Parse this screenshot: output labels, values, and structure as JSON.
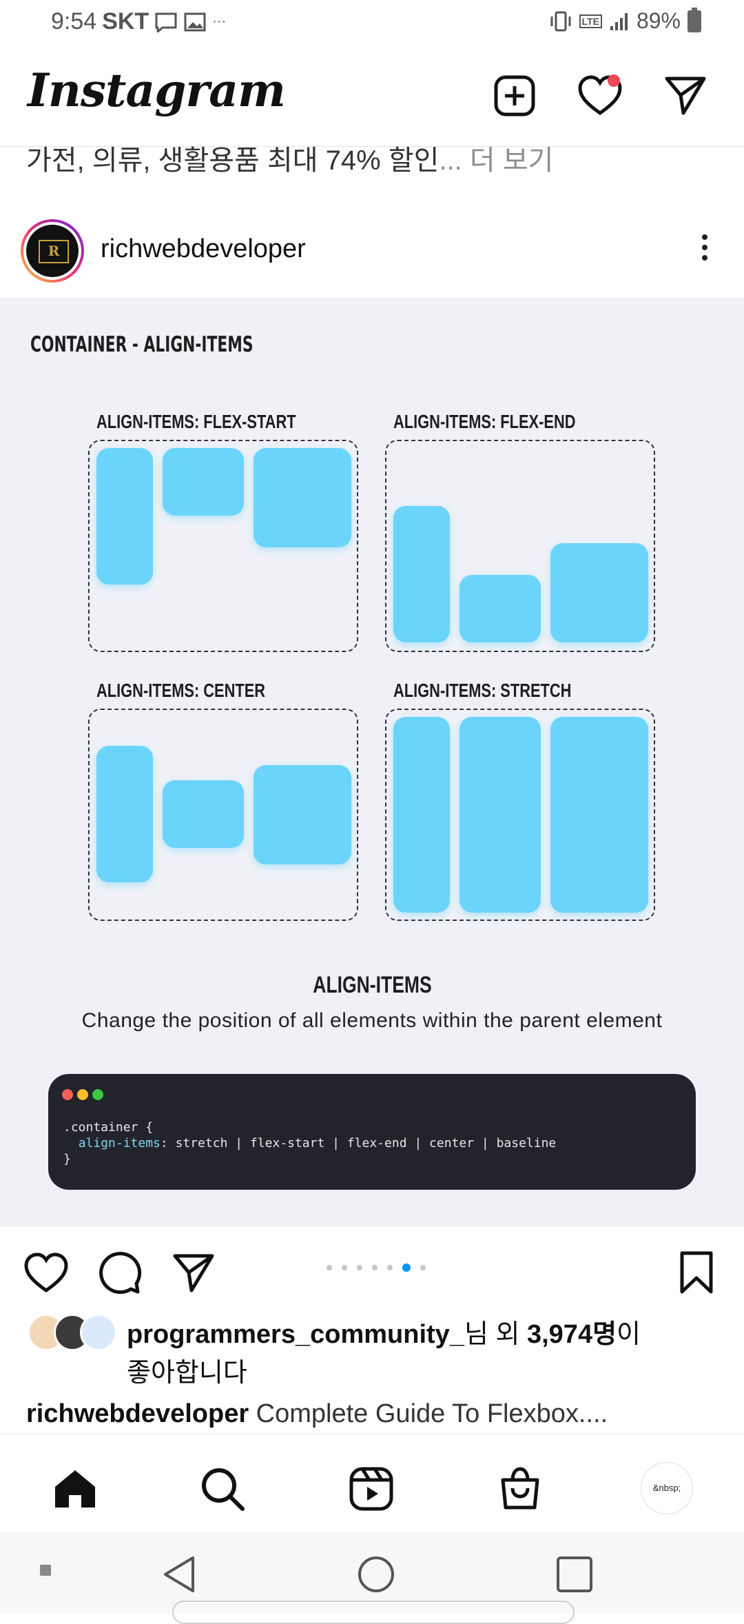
{
  "status_bar": {
    "time": "9:54",
    "carrier": "SKT",
    "more": "···",
    "network": "LTE",
    "battery": "89%"
  },
  "header": {
    "logo": "Instagram",
    "icons": [
      "new-post-icon",
      "heart-icon",
      "send-icon"
    ]
  },
  "previous_post": {
    "caption_cut": "가전, 의류, 생활용품 최대 74% 할인",
    "more_label": "... 더 보기"
  },
  "post": {
    "username": "richwebdeveloper",
    "avatar_letter": "R",
    "image": {
      "title": "CONTAINER - ALIGN-ITEMS",
      "panels": [
        {
          "label": "ALIGN-ITEMS: FLEX-START"
        },
        {
          "label": "ALIGN-ITEMS: FLEX-END"
        },
        {
          "label": "ALIGN-ITEMS: CENTER"
        },
        {
          "label": "ALIGN-ITEMS: STRETCH"
        }
      ],
      "section_title": "ALIGN-ITEMS",
      "description": "Change the position of all elements within the parent element",
      "code": {
        "line1": ".container {",
        "prop": "align-items",
        "values": ": stretch | flex-start | flex-end | center | baseline",
        "line3": "}"
      },
      "colors": {
        "box": "#6ad4fb",
        "background": "#eff1f7",
        "code_bg": "#23232b"
      }
    },
    "carousel": {
      "count": 7,
      "active_index": 5
    },
    "likes": {
      "user": "programmers_community_",
      "mid": "님 외 ",
      "count": "3,974명",
      "suffix": "이",
      "line2": "좋아합니다"
    },
    "caption": {
      "user": "richwebdeveloper",
      "text": " Complete Guide To Flexbox...."
    }
  },
  "bottom_nav": {
    "items": [
      "home-icon",
      "search-icon",
      "reels-icon",
      "shop-icon"
    ],
    "profile_text": "&nbsp;"
  }
}
